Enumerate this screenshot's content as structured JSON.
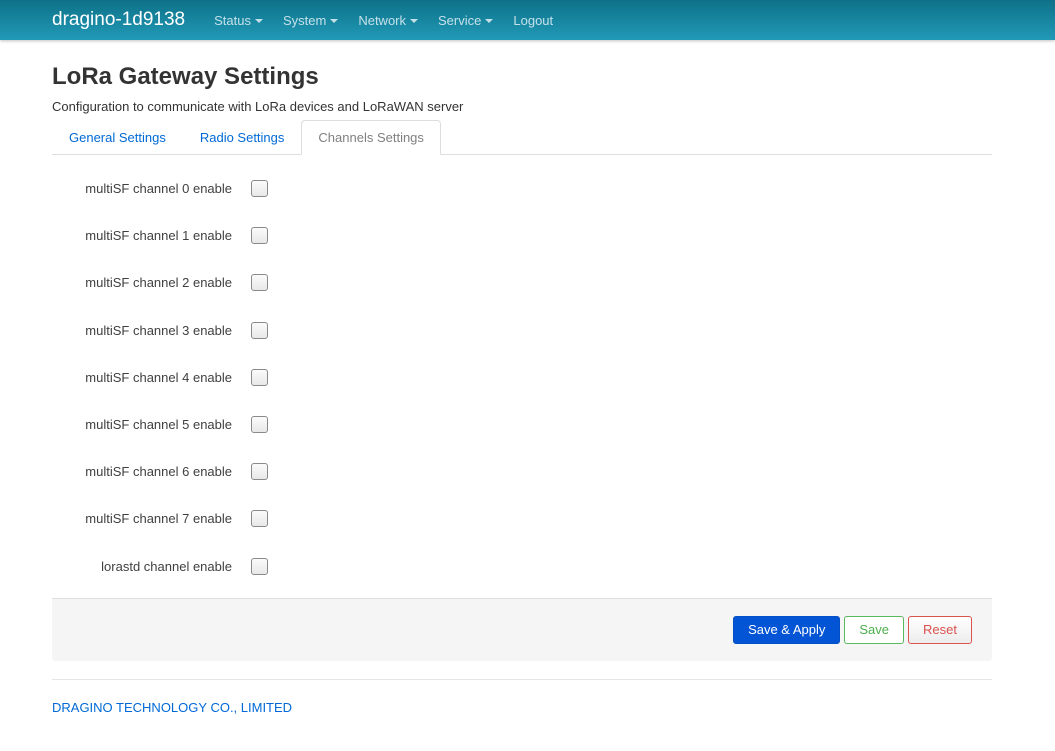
{
  "navbar": {
    "brand": "dragino-1d9138",
    "items": [
      {
        "label": "Status",
        "dropdown": true
      },
      {
        "label": "System",
        "dropdown": true
      },
      {
        "label": "Network",
        "dropdown": true
      },
      {
        "label": "Service",
        "dropdown": true
      },
      {
        "label": "Logout",
        "dropdown": false
      }
    ]
  },
  "page": {
    "title": "LoRa Gateway Settings",
    "description": "Configuration to communicate with LoRa devices and LoRaWAN server"
  },
  "tabs": [
    {
      "label": "General Settings",
      "active": false
    },
    {
      "label": "Radio Settings",
      "active": false
    },
    {
      "label": "Channels Settings",
      "active": true
    }
  ],
  "fields": [
    {
      "label": "multiSF channel 0 enable",
      "checked": false
    },
    {
      "label": "multiSF channel 1 enable",
      "checked": false
    },
    {
      "label": "multiSF channel 2 enable",
      "checked": false
    },
    {
      "label": "multiSF channel 3 enable",
      "checked": false
    },
    {
      "label": "multiSF channel 4 enable",
      "checked": false
    },
    {
      "label": "multiSF channel 5 enable",
      "checked": false
    },
    {
      "label": "multiSF channel 6 enable",
      "checked": false
    },
    {
      "label": "multiSF channel 7 enable",
      "checked": false
    },
    {
      "label": "lorastd channel enable",
      "checked": false
    }
  ],
  "actions": {
    "save_apply": "Save & Apply",
    "save": "Save",
    "reset": "Reset"
  },
  "footer": {
    "company": "DRAGINO TECHNOLOGY CO., LIMITED"
  },
  "icons": {
    "dropdown": "caret-down-icon",
    "checkbox": "checkbox-unchecked"
  }
}
